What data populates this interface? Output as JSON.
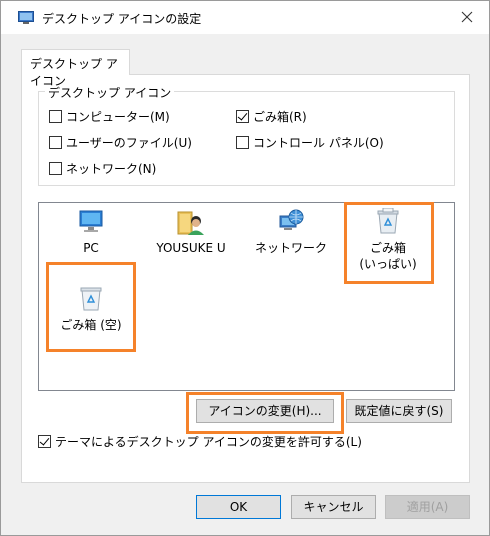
{
  "window": {
    "title": "デスクトップ アイコンの設定"
  },
  "tab": {
    "label": "デスクトップ アイコン"
  },
  "group": {
    "title": "デスクトップ アイコン",
    "checkboxes": [
      {
        "label": "コンピューター(M)",
        "checked": false
      },
      {
        "label": "ごみ箱(R)",
        "checked": true
      },
      {
        "label": "ユーザーのファイル(U)",
        "checked": false
      },
      {
        "label": "コントロール パネル(O)",
        "checked": false
      },
      {
        "label": "ネットワーク(N)",
        "checked": false
      }
    ]
  },
  "icons": [
    {
      "label": "PC",
      "icon": "pc-monitor-icon"
    },
    {
      "label": "YOUSUKE U",
      "icon": "user-folder-icon"
    },
    {
      "label": "ネットワーク",
      "icon": "network-globe-icon"
    },
    {
      "label": "ごみ箱",
      "label2": "(いっぱい)",
      "icon": "recycle-bin-full-icon"
    },
    {
      "label": "ごみ箱 (空)",
      "icon": "recycle-bin-empty-icon"
    }
  ],
  "buttons": {
    "change_icon": "アイコンの変更(H)...",
    "restore_default": "既定値に戻す(S)",
    "ok": "OK",
    "cancel": "キャンセル",
    "apply": "適用(A)"
  },
  "theme_checkbox": {
    "label": "テーマによるデスクトップ アイコンの変更を許可する(L)",
    "checked": true
  },
  "colors": {
    "highlight": "#f5822a",
    "accent": "#0078d7"
  }
}
